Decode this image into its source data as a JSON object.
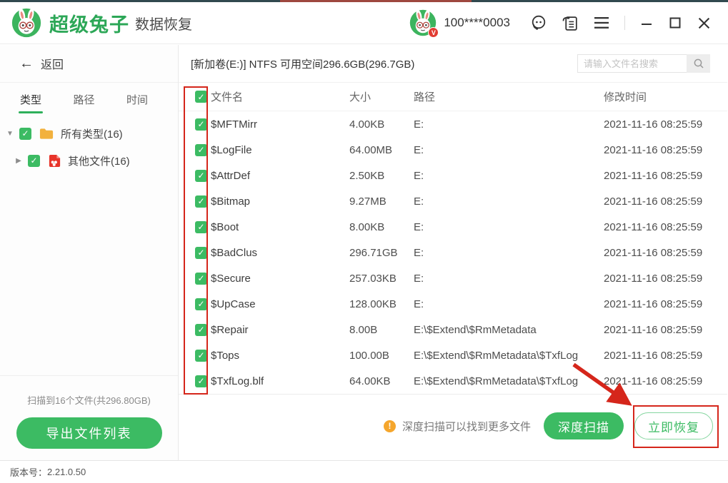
{
  "window": {
    "brand": "超级兔子",
    "brand_suffix": "数据恢复",
    "account": "100****0003",
    "version_label": "版本号：",
    "version": "2.21.0.50"
  },
  "sidebar": {
    "back_label": "返回",
    "tabs": [
      {
        "label": "类型",
        "active": true
      },
      {
        "label": "路径",
        "active": false
      },
      {
        "label": "时间",
        "active": false
      }
    ],
    "tree": [
      {
        "label": "所有类型(16)",
        "icon": "folder-icon",
        "expanded": true,
        "checked": true
      },
      {
        "label": "其他文件(16)",
        "icon": "other-files-icon",
        "expanded": false,
        "checked": true
      }
    ],
    "scan_summary": "扫描到16个文件(共296.80GB)",
    "export_button": "导出文件列表"
  },
  "toolbar": {
    "volume_info": "[新加卷(E:)] NTFS 可用空间296.6GB(296.7GB)",
    "search_placeholder": "请输入文件名搜索"
  },
  "table": {
    "headers": {
      "name": "文件名",
      "size": "大小",
      "path": "路径",
      "modified": "修改时间"
    },
    "all_checked": true,
    "rows": [
      {
        "name": "$MFTMirr",
        "size": "4.00KB",
        "path": "E:",
        "modified": "2021-11-16 08:25:59",
        "checked": true
      },
      {
        "name": "$LogFile",
        "size": "64.00MB",
        "path": "E:",
        "modified": "2021-11-16 08:25:59",
        "checked": true
      },
      {
        "name": "$AttrDef",
        "size": "2.50KB",
        "path": "E:",
        "modified": "2021-11-16 08:25:59",
        "checked": true
      },
      {
        "name": "$Bitmap",
        "size": "9.27MB",
        "path": "E:",
        "modified": "2021-11-16 08:25:59",
        "checked": true
      },
      {
        "name": "$Boot",
        "size": "8.00KB",
        "path": "E:",
        "modified": "2021-11-16 08:25:59",
        "checked": true
      },
      {
        "name": "$BadClus",
        "size": "296.71GB",
        "path": "E:",
        "modified": "2021-11-16 08:25:59",
        "checked": true
      },
      {
        "name": "$Secure",
        "size": "257.03KB",
        "path": "E:",
        "modified": "2021-11-16 08:25:59",
        "checked": true
      },
      {
        "name": "$UpCase",
        "size": "128.00KB",
        "path": "E:",
        "modified": "2021-11-16 08:25:59",
        "checked": true
      },
      {
        "name": "$Repair",
        "size": "8.00B",
        "path": "E:\\$Extend\\$RmMetadata",
        "modified": "2021-11-16 08:25:59",
        "checked": true
      },
      {
        "name": "$Tops",
        "size": "100.00B",
        "path": "E:\\$Extend\\$RmMetadata\\$TxfLog",
        "modified": "2021-11-16 08:25:59",
        "checked": true
      },
      {
        "name": "$TxfLog.blf",
        "size": "64.00KB",
        "path": "E:\\$Extend\\$RmMetadata\\$TxfLog",
        "modified": "2021-11-16 08:25:59",
        "checked": true
      }
    ]
  },
  "footer": {
    "hint": "深度扫描可以找到更多文件",
    "deep_scan_button": "深度扫描",
    "recover_button": "立即恢复"
  },
  "colors": {
    "accent_green": "#3cbb63",
    "annotation_red": "#d5261b",
    "warning_orange": "#f5a62c",
    "folder_yellow": "#f2b13d",
    "other_file_red": "#e8342a",
    "badge_red": "#e23d33",
    "topline_dark": "#31494f"
  }
}
